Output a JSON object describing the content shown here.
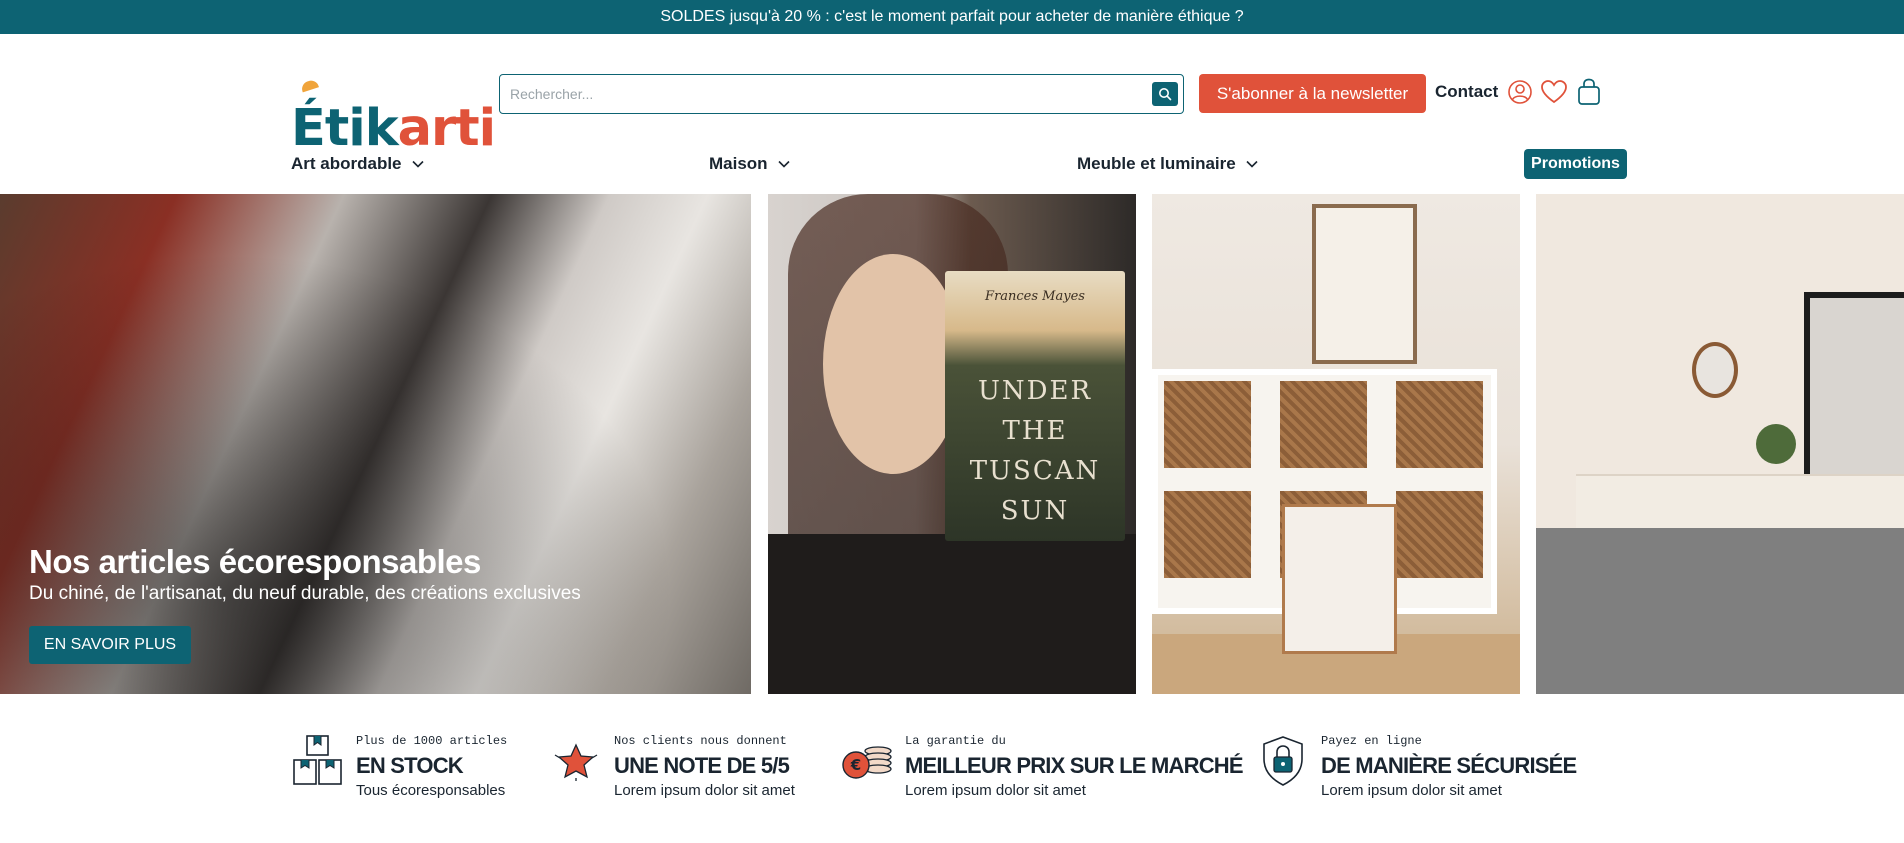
{
  "topbar": {
    "text": "SOLDES jusqu'à 20 % : c'est le moment parfait pour acheter de manière éthique ?"
  },
  "header": {
    "logo": {
      "part1": "Étik",
      "part2": "arti"
    },
    "search": {
      "placeholder": "Rechercher..."
    },
    "newsletter_label": "S'abonner à la newsletter",
    "contact_label": "Contact",
    "icons": [
      "user-icon",
      "heart-icon",
      "shopping-bag-icon",
      "search-icon"
    ]
  },
  "nav": {
    "items": [
      {
        "label": "Art abordable"
      },
      {
        "label": "Maison"
      },
      {
        "label": "Meuble et luminaire"
      }
    ],
    "promo_label": "Promotions"
  },
  "hero": {
    "title": "Nos articles écoresponsables",
    "subtitle": "Du chiné, de l'artisanat, du neuf durable, des créations exclusives",
    "cta_label": "EN SAVOIR PLUS",
    "book": {
      "author": "Frances Mayes",
      "line1": "UNDER",
      "line2": "THE",
      "line3": "TUSCAN",
      "line4": "SUN"
    }
  },
  "features": [
    {
      "small": "Plus de 1000 articles",
      "big": "EN STOCK",
      "desc": "Tous écoresponsables",
      "icon": "boxes-icon"
    },
    {
      "small": "Nos clients nous donnent",
      "big": "UNE NOTE DE 5/5",
      "desc": "Lorem ipsum dolor sit amet",
      "icon": "star-icon"
    },
    {
      "small": "La garantie du",
      "big": "MEILLEUR PRIX SUR LE MARCHÉ",
      "desc": "Lorem ipsum dolor sit amet",
      "icon": "coins-icon"
    },
    {
      "small": "Payez en ligne",
      "big": "DE MANIÈRE SÉCURISÉE",
      "desc": "Lorem ipsum dolor sit amet",
      "icon": "shield-lock-icon"
    }
  ],
  "colors": {
    "primary": "#0d6373",
    "accent": "#e0523a",
    "logo_accent": "#f0a43b"
  }
}
